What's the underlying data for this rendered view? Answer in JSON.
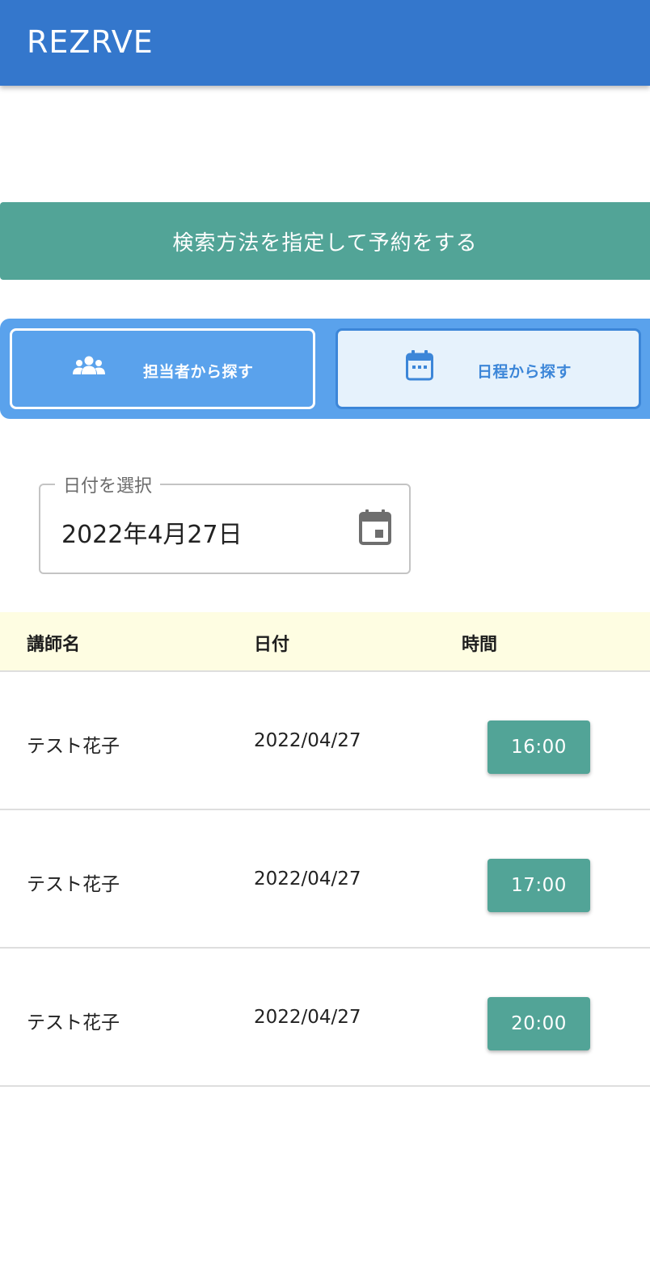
{
  "app": {
    "title": "REZRVE"
  },
  "banner": {
    "text": "検索方法を指定して予約をする"
  },
  "modes": {
    "staff": {
      "label": "担当者から探す",
      "icon": "people-icon"
    },
    "schedule": {
      "label": "日程から探す",
      "icon": "calendar-icon"
    }
  },
  "date_picker": {
    "label": "日付を選択",
    "value": "2022年4月27日",
    "icon": "calendar-event-icon"
  },
  "table": {
    "headers": {
      "instructor": "講師名",
      "date": "日付",
      "time": "時間"
    },
    "rows": [
      {
        "instructor": "テスト花子",
        "date": "2022/04/27",
        "time": "16:00"
      },
      {
        "instructor": "テスト花子",
        "date": "2022/04/27",
        "time": "17:00"
      },
      {
        "instructor": "テスト花子",
        "date": "2022/04/27",
        "time": "20:00"
      }
    ]
  },
  "colors": {
    "appbar": "#3477cc",
    "accent_teal": "#52a497",
    "mode_bar": "#5aa2ec",
    "header_row": "#fefde2"
  }
}
